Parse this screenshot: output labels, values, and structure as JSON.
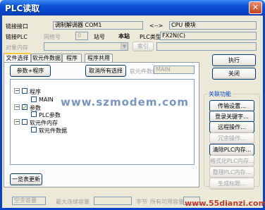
{
  "window": {
    "title": "PLC读取",
    "close_glyph": "✕"
  },
  "connection": {
    "link_port_label": "链接接口",
    "link_port_value": "调制解调器 COM1",
    "arrow": "<-->",
    "cpu_module_value": "CPU 模块",
    "link_plc_label": "链接PLC",
    "network_no_label": "网络号",
    "network_no_value": "0",
    "station_no_label": "站号",
    "station_no_value": "本站",
    "plc_type_label": "PLC类型",
    "plc_type_value": "FX2N(C)"
  },
  "target_memory": {
    "label": "对象内存",
    "value": "",
    "title_button": "索引"
  },
  "tabs": [
    "文件选择",
    "软元件数据",
    "程序",
    "程序共用"
  ],
  "file_selection": {
    "params_program_button": "参数+程序",
    "deselect_all_button": "取消所有选择",
    "device_data_name_label": "软元件数据名",
    "device_data_name_value": "MAIN"
  },
  "tree": [
    {
      "label": "程序",
      "checked": false,
      "expander": "−"
    },
    {
      "label": "MAIN",
      "checked": false
    },
    {
      "label": "参数",
      "checked": true,
      "expander": "−"
    },
    {
      "label": "PLC参数",
      "checked": false
    },
    {
      "label": "软元件内存",
      "checked": false,
      "expander": "−"
    },
    {
      "label": "软元件数据",
      "checked": false
    }
  ],
  "list_update_button": "一览表更新",
  "right_buttons": {
    "execute": "执行",
    "close": "关闭"
  },
  "related_functions": {
    "title": "关联功能",
    "buttons": [
      {
        "label": "传输设置...",
        "enabled": true
      },
      {
        "label": "登录关键字...",
        "enabled": true
      },
      {
        "label": "远程操作...",
        "enabled": true
      },
      {
        "label": "冗余操作...",
        "enabled": false
      },
      {
        "label": "清除PLC内存...",
        "enabled": true
      },
      {
        "label": "格式化PLC内存...",
        "enabled": false
      },
      {
        "label": "整理PLC内存...",
        "enabled": false
      },
      {
        "label": "生成标题...",
        "enabled": false
      }
    ]
  },
  "status": {
    "free_capacity_label": "空余容量",
    "max_continuous_label": "最大连续容量",
    "byte_unit": "字节",
    "total_free_label": "所有可用容量"
  },
  "watermarks": {
    "center": "www.szmodem.com",
    "corner": "www.55dianzi.com"
  }
}
